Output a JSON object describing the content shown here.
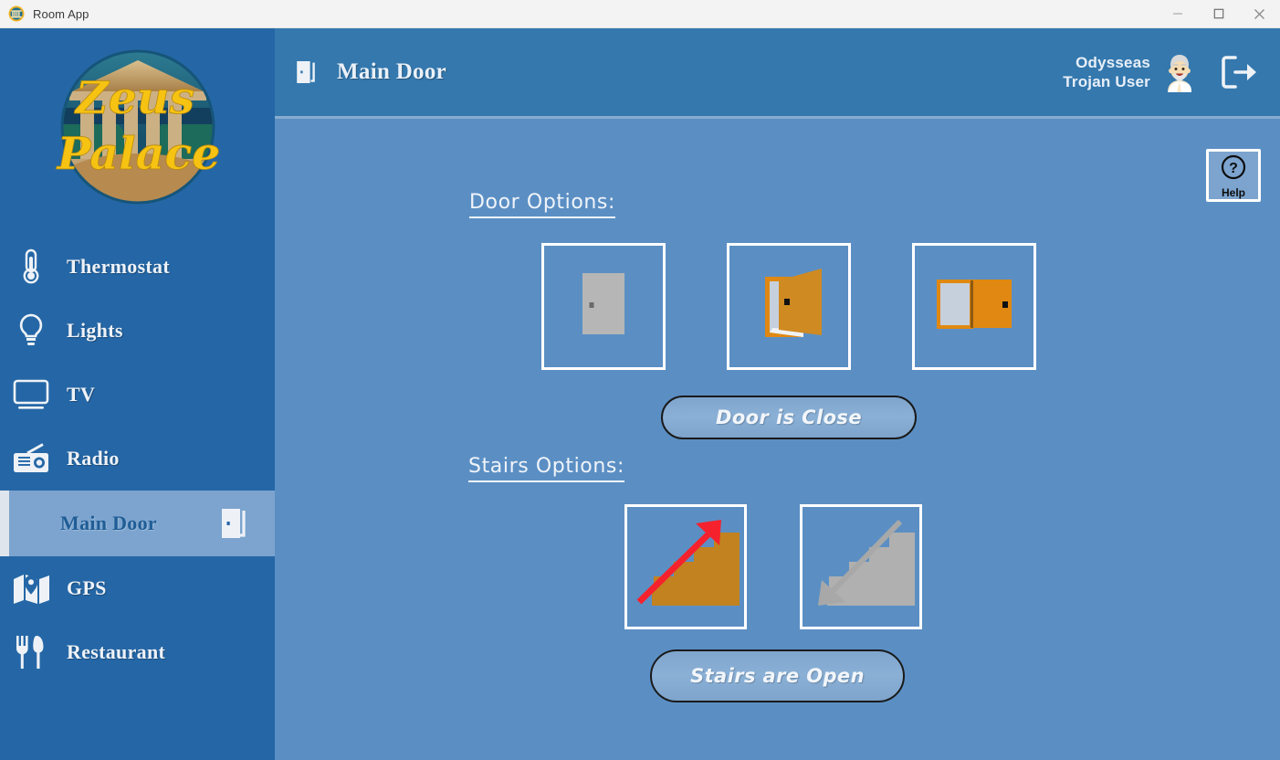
{
  "window": {
    "title": "Room App",
    "icon": "app-logo-icon",
    "controls": {
      "minimize": "minimize-icon",
      "maximize": "maximize-icon",
      "close": "close-icon"
    }
  },
  "sidebar": {
    "logo": {
      "line1": "Zeus",
      "line2": "Palace",
      "alt": "zeus-palace-logo"
    },
    "items": [
      {
        "label": "Thermostat",
        "icon": "thermostat-icon",
        "active": false
      },
      {
        "label": "Lights",
        "icon": "lightbulb-icon",
        "active": false
      },
      {
        "label": "TV",
        "icon": "tv-icon",
        "active": false
      },
      {
        "label": "Radio",
        "icon": "radio-icon",
        "active": false
      },
      {
        "label": "Main Door",
        "icon": "door-icon",
        "active": true
      },
      {
        "label": "GPS",
        "icon": "map-icon",
        "active": false
      },
      {
        "label": "Restaurant",
        "icon": "cutlery-icon",
        "active": false
      }
    ]
  },
  "header": {
    "icon": "door-icon",
    "title": "Main Door",
    "user": {
      "first_name": "Odysseas",
      "role": "Trojan User",
      "avatar": "old-man-avatar"
    },
    "logout": "logout-icon"
  },
  "main": {
    "help": {
      "label": "Help",
      "icon": "question-mark-circle-icon"
    },
    "door_section": {
      "heading": "Door Options:",
      "options": [
        {
          "name": "door-closed-option",
          "icon": "door-closed-icon"
        },
        {
          "name": "door-ajar-option",
          "icon": "door-ajar-icon"
        },
        {
          "name": "door-open-option",
          "icon": "door-open-icon"
        }
      ],
      "status_label": "Door is Close"
    },
    "stairs_section": {
      "heading": "Stairs Options:",
      "options": [
        {
          "name": "stairs-up-option",
          "icon": "stairs-up-arrow-icon"
        },
        {
          "name": "stairs-down-option",
          "icon": "stairs-down-arrow-icon"
        }
      ],
      "status_label": "Stairs are Open"
    }
  },
  "colors": {
    "sidebar_blue": "#2567a6",
    "header_blue": "#3478ae",
    "body_blue": "#5b8fc4",
    "active_blue": "#7ca4ce",
    "door_orange": "#d9901f",
    "door_gray": "#b6b6b6",
    "arrow_red": "#ec1c2a",
    "logo_gold": "#f7c313"
  }
}
